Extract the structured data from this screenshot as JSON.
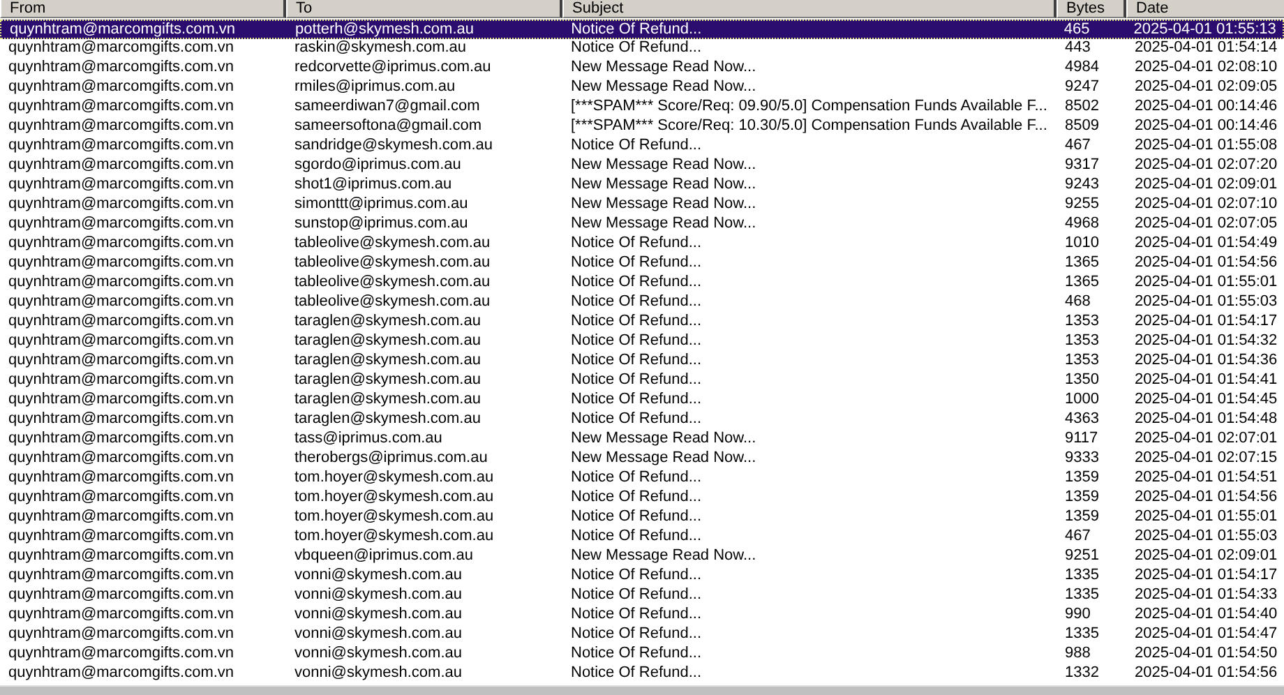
{
  "table": {
    "columns": [
      "From",
      "To",
      "Subject",
      "Bytes",
      "Date"
    ],
    "rows": [
      {
        "from": "quynhtram@marcomgifts.com.vn",
        "to": "potterh@skymesh.com.au",
        "subject": "Notice Of Refund...",
        "bytes": "465",
        "date": "2025-04-01 01:55:13",
        "selected": true
      },
      {
        "from": "quynhtram@marcomgifts.com.vn",
        "to": "raskin@skymesh.com.au",
        "subject": "Notice Of Refund...",
        "bytes": "443",
        "date": "2025-04-01 01:54:14",
        "selected": false
      },
      {
        "from": "quynhtram@marcomgifts.com.vn",
        "to": "redcorvette@iprimus.com.au",
        "subject": "New Message Read Now...",
        "bytes": "4984",
        "date": "2025-04-01 02:08:10",
        "selected": false
      },
      {
        "from": "quynhtram@marcomgifts.com.vn",
        "to": "rmiles@iprimus.com.au",
        "subject": "New Message Read Now...",
        "bytes": "9247",
        "date": "2025-04-01 02:09:05",
        "selected": false
      },
      {
        "from": "quynhtram@marcomgifts.com.vn",
        "to": "sameerdiwan7@gmail.com",
        "subject": "[***SPAM*** Score/Req: 09.90/5.0] Compensation Funds Available F...",
        "bytes": "8502",
        "date": "2025-04-01 00:14:46",
        "selected": false
      },
      {
        "from": "quynhtram@marcomgifts.com.vn",
        "to": "sameersoftona@gmail.com",
        "subject": "[***SPAM*** Score/Req: 10.30/5.0] Compensation Funds Available F...",
        "bytes": "8509",
        "date": "2025-04-01 00:14:46",
        "selected": false
      },
      {
        "from": "quynhtram@marcomgifts.com.vn",
        "to": "sandridge@skymesh.com.au",
        "subject": "Notice Of Refund...",
        "bytes": "467",
        "date": "2025-04-01 01:55:08",
        "selected": false
      },
      {
        "from": "quynhtram@marcomgifts.com.vn",
        "to": "sgordo@iprimus.com.au",
        "subject": "New Message Read Now...",
        "bytes": "9317",
        "date": "2025-04-01 02:07:20",
        "selected": false
      },
      {
        "from": "quynhtram@marcomgifts.com.vn",
        "to": "shot1@iprimus.com.au",
        "subject": "New Message Read Now...",
        "bytes": "9243",
        "date": "2025-04-01 02:09:01",
        "selected": false
      },
      {
        "from": "quynhtram@marcomgifts.com.vn",
        "to": "simonttt@iprimus.com.au",
        "subject": "New Message Read Now...",
        "bytes": "9255",
        "date": "2025-04-01 02:07:10",
        "selected": false
      },
      {
        "from": "quynhtram@marcomgifts.com.vn",
        "to": "sunstop@iprimus.com.au",
        "subject": "New Message Read Now...",
        "bytes": "4968",
        "date": "2025-04-01 02:07:05",
        "selected": false
      },
      {
        "from": "quynhtram@marcomgifts.com.vn",
        "to": "tableolive@skymesh.com.au",
        "subject": "Notice Of Refund...",
        "bytes": "1010",
        "date": "2025-04-01 01:54:49",
        "selected": false
      },
      {
        "from": "quynhtram@marcomgifts.com.vn",
        "to": "tableolive@skymesh.com.au",
        "subject": "Notice Of Refund...",
        "bytes": "1365",
        "date": "2025-04-01 01:54:56",
        "selected": false
      },
      {
        "from": "quynhtram@marcomgifts.com.vn",
        "to": "tableolive@skymesh.com.au",
        "subject": "Notice Of Refund...",
        "bytes": "1365",
        "date": "2025-04-01 01:55:01",
        "selected": false
      },
      {
        "from": "quynhtram@marcomgifts.com.vn",
        "to": "tableolive@skymesh.com.au",
        "subject": "Notice Of Refund...",
        "bytes": "468",
        "date": "2025-04-01 01:55:03",
        "selected": false
      },
      {
        "from": "quynhtram@marcomgifts.com.vn",
        "to": "taraglen@skymesh.com.au",
        "subject": "Notice Of Refund...",
        "bytes": "1353",
        "date": "2025-04-01 01:54:17",
        "selected": false
      },
      {
        "from": "quynhtram@marcomgifts.com.vn",
        "to": "taraglen@skymesh.com.au",
        "subject": "Notice Of Refund...",
        "bytes": "1353",
        "date": "2025-04-01 01:54:32",
        "selected": false
      },
      {
        "from": "quynhtram@marcomgifts.com.vn",
        "to": "taraglen@skymesh.com.au",
        "subject": "Notice Of Refund...",
        "bytes": "1353",
        "date": "2025-04-01 01:54:36",
        "selected": false
      },
      {
        "from": "quynhtram@marcomgifts.com.vn",
        "to": "taraglen@skymesh.com.au",
        "subject": "Notice Of Refund...",
        "bytes": "1350",
        "date": "2025-04-01 01:54:41",
        "selected": false
      },
      {
        "from": "quynhtram@marcomgifts.com.vn",
        "to": "taraglen@skymesh.com.au",
        "subject": "Notice Of Refund...",
        "bytes": "1000",
        "date": "2025-04-01 01:54:45",
        "selected": false
      },
      {
        "from": "quynhtram@marcomgifts.com.vn",
        "to": "taraglen@skymesh.com.au",
        "subject": "Notice Of Refund...",
        "bytes": "4363",
        "date": "2025-04-01 01:54:48",
        "selected": false
      },
      {
        "from": "quynhtram@marcomgifts.com.vn",
        "to": "tass@iprimus.com.au",
        "subject": "New Message Read Now...",
        "bytes": "9117",
        "date": "2025-04-01 02:07:01",
        "selected": false
      },
      {
        "from": "quynhtram@marcomgifts.com.vn",
        "to": "therobergs@iprimus.com.au",
        "subject": "New Message Read Now...",
        "bytes": "9333",
        "date": "2025-04-01 02:07:15",
        "selected": false
      },
      {
        "from": "quynhtram@marcomgifts.com.vn",
        "to": "tom.hoyer@skymesh.com.au",
        "subject": "Notice Of Refund...",
        "bytes": "1359",
        "date": "2025-04-01 01:54:51",
        "selected": false
      },
      {
        "from": "quynhtram@marcomgifts.com.vn",
        "to": "tom.hoyer@skymesh.com.au",
        "subject": "Notice Of Refund...",
        "bytes": "1359",
        "date": "2025-04-01 01:54:56",
        "selected": false
      },
      {
        "from": "quynhtram@marcomgifts.com.vn",
        "to": "tom.hoyer@skymesh.com.au",
        "subject": "Notice Of Refund...",
        "bytes": "1359",
        "date": "2025-04-01 01:55:01",
        "selected": false
      },
      {
        "from": "quynhtram@marcomgifts.com.vn",
        "to": "tom.hoyer@skymesh.com.au",
        "subject": "Notice Of Refund...",
        "bytes": "467",
        "date": "2025-04-01 01:55:03",
        "selected": false
      },
      {
        "from": "quynhtram@marcomgifts.com.vn",
        "to": "vbqueen@iprimus.com.au",
        "subject": "New Message Read Now...",
        "bytes": "9251",
        "date": "2025-04-01 02:09:01",
        "selected": false
      },
      {
        "from": "quynhtram@marcomgifts.com.vn",
        "to": "vonni@skymesh.com.au",
        "subject": "Notice Of Refund...",
        "bytes": "1335",
        "date": "2025-04-01 01:54:17",
        "selected": false
      },
      {
        "from": "quynhtram@marcomgifts.com.vn",
        "to": "vonni@skymesh.com.au",
        "subject": "Notice Of Refund...",
        "bytes": "1335",
        "date": "2025-04-01 01:54:33",
        "selected": false
      },
      {
        "from": "quynhtram@marcomgifts.com.vn",
        "to": "vonni@skymesh.com.au",
        "subject": "Notice Of Refund...",
        "bytes": "990",
        "date": "2025-04-01 01:54:40",
        "selected": false
      },
      {
        "from": "quynhtram@marcomgifts.com.vn",
        "to": "vonni@skymesh.com.au",
        "subject": "Notice Of Refund...",
        "bytes": "1335",
        "date": "2025-04-01 01:54:47",
        "selected": false
      },
      {
        "from": "quynhtram@marcomgifts.com.vn",
        "to": "vonni@skymesh.com.au",
        "subject": "Notice Of Refund...",
        "bytes": "988",
        "date": "2025-04-01 01:54:50",
        "selected": false
      },
      {
        "from": "quynhtram@marcomgifts.com.vn",
        "to": "vonni@skymesh.com.au",
        "subject": "Notice Of Refund...",
        "bytes": "1332",
        "date": "2025-04-01 01:54:56",
        "selected": false
      }
    ]
  }
}
